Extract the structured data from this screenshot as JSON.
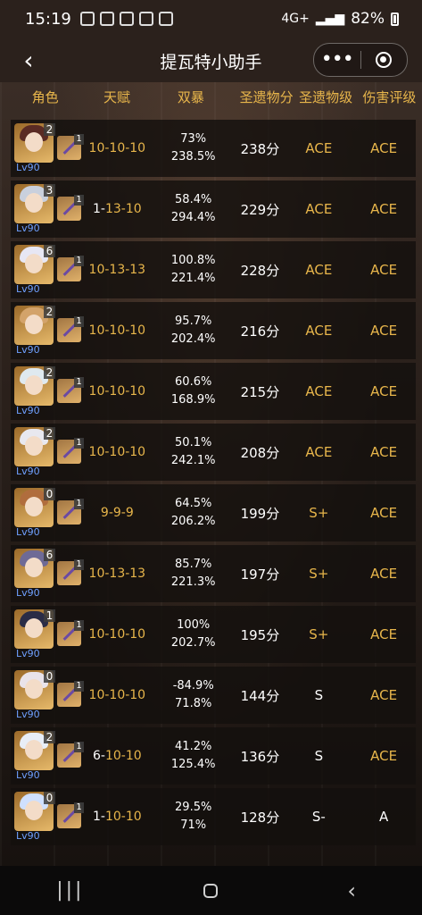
{
  "status": {
    "time": "15:19",
    "battery": "82%",
    "network": "4G+"
  },
  "title_bar": {
    "title": "提瓦特小助手",
    "more": "•••"
  },
  "columns": [
    "角色",
    "天赋",
    "双暴",
    "圣遗物分",
    "圣遗物级",
    "伤害评级"
  ],
  "rows": [
    {
      "const": "2",
      "refine": "1",
      "lv": "Lv90",
      "talent": [
        "10-10-10"
      ],
      "talent_hi": true,
      "crit_rate": "73%",
      "crit_dmg": "238.5%",
      "score": "238分",
      "grade": "ACE",
      "dmg": "ACE",
      "grade_white": false,
      "dmg_white": false
    },
    {
      "const": "3",
      "refine": "1",
      "lv": "Lv90",
      "talent_parts": [
        "1-",
        "13-10"
      ],
      "crit_rate": "58.4%",
      "crit_dmg": "294.4%",
      "score": "229分",
      "grade": "ACE",
      "dmg": "ACE",
      "grade_white": false,
      "dmg_white": false
    },
    {
      "const": "6",
      "refine": "1",
      "lv": "Lv90",
      "talent": [
        "10-13-13"
      ],
      "talent_hi": true,
      "crit_rate": "100.8%",
      "crit_dmg": "221.4%",
      "score": "228分",
      "grade": "ACE",
      "dmg": "ACE",
      "grade_white": false,
      "dmg_white": false
    },
    {
      "const": "2",
      "refine": "1",
      "lv": "Lv90",
      "talent": [
        "10-10-10"
      ],
      "talent_hi": true,
      "crit_rate": "95.7%",
      "crit_dmg": "202.4%",
      "score": "216分",
      "grade": "ACE",
      "dmg": "ACE",
      "grade_white": false,
      "dmg_white": false
    },
    {
      "const": "2",
      "refine": "1",
      "lv": "Lv90",
      "talent": [
        "10-10-10"
      ],
      "talent_hi": true,
      "crit_rate": "60.6%",
      "crit_dmg": "168.9%",
      "score": "215分",
      "grade": "ACE",
      "dmg": "ACE",
      "grade_white": false,
      "dmg_white": false
    },
    {
      "const": "2",
      "refine": "1",
      "lv": "Lv90",
      "talent": [
        "10-10-10"
      ],
      "talent_hi": true,
      "crit_rate": "50.1%",
      "crit_dmg": "242.1%",
      "score": "208分",
      "grade": "ACE",
      "dmg": "ACE",
      "grade_white": false,
      "dmg_white": false
    },
    {
      "const": "0",
      "refine": "1",
      "lv": "Lv90",
      "talent": [
        "9-9-9"
      ],
      "talent_hi": true,
      "crit_rate": "64.5%",
      "crit_dmg": "206.2%",
      "score": "199分",
      "grade": "S+",
      "dmg": "ACE",
      "grade_white": false,
      "dmg_white": false
    },
    {
      "const": "6",
      "refine": "1",
      "lv": "Lv90",
      "talent": [
        "10-13-13"
      ],
      "talent_hi": true,
      "crit_rate": "85.7%",
      "crit_dmg": "221.3%",
      "score": "197分",
      "grade": "S+",
      "dmg": "ACE",
      "grade_white": false,
      "dmg_white": false
    },
    {
      "const": "1",
      "refine": "1",
      "lv": "Lv90",
      "talent": [
        "10-10-10"
      ],
      "talent_hi": true,
      "crit_rate": "100%",
      "crit_dmg": "202.7%",
      "score": "195分",
      "grade": "S+",
      "dmg": "ACE",
      "grade_white": false,
      "dmg_white": false
    },
    {
      "const": "0",
      "refine": "1",
      "lv": "Lv90",
      "talent": [
        "10-10-10"
      ],
      "talent_hi": true,
      "crit_rate": "-84.9%",
      "crit_dmg": "71.8%",
      "score": "144分",
      "grade": "S",
      "dmg": "ACE",
      "grade_white": true,
      "dmg_white": false
    },
    {
      "const": "2",
      "refine": "1",
      "lv": "Lv90",
      "talent_parts": [
        "6-",
        "10-10"
      ],
      "crit_rate": "41.2%",
      "crit_dmg": "125.4%",
      "score": "136分",
      "grade": "S",
      "dmg": "ACE",
      "grade_white": true,
      "dmg_white": false
    },
    {
      "const": "0",
      "refine": "1",
      "lv": "Lv90",
      "talent_parts": [
        "1-",
        "10-10"
      ],
      "crit_rate": "29.5%",
      "crit_dmg": "71%",
      "score": "128分",
      "grade": "S-",
      "dmg": "A",
      "grade_white": true,
      "dmg_white": true
    }
  ]
}
